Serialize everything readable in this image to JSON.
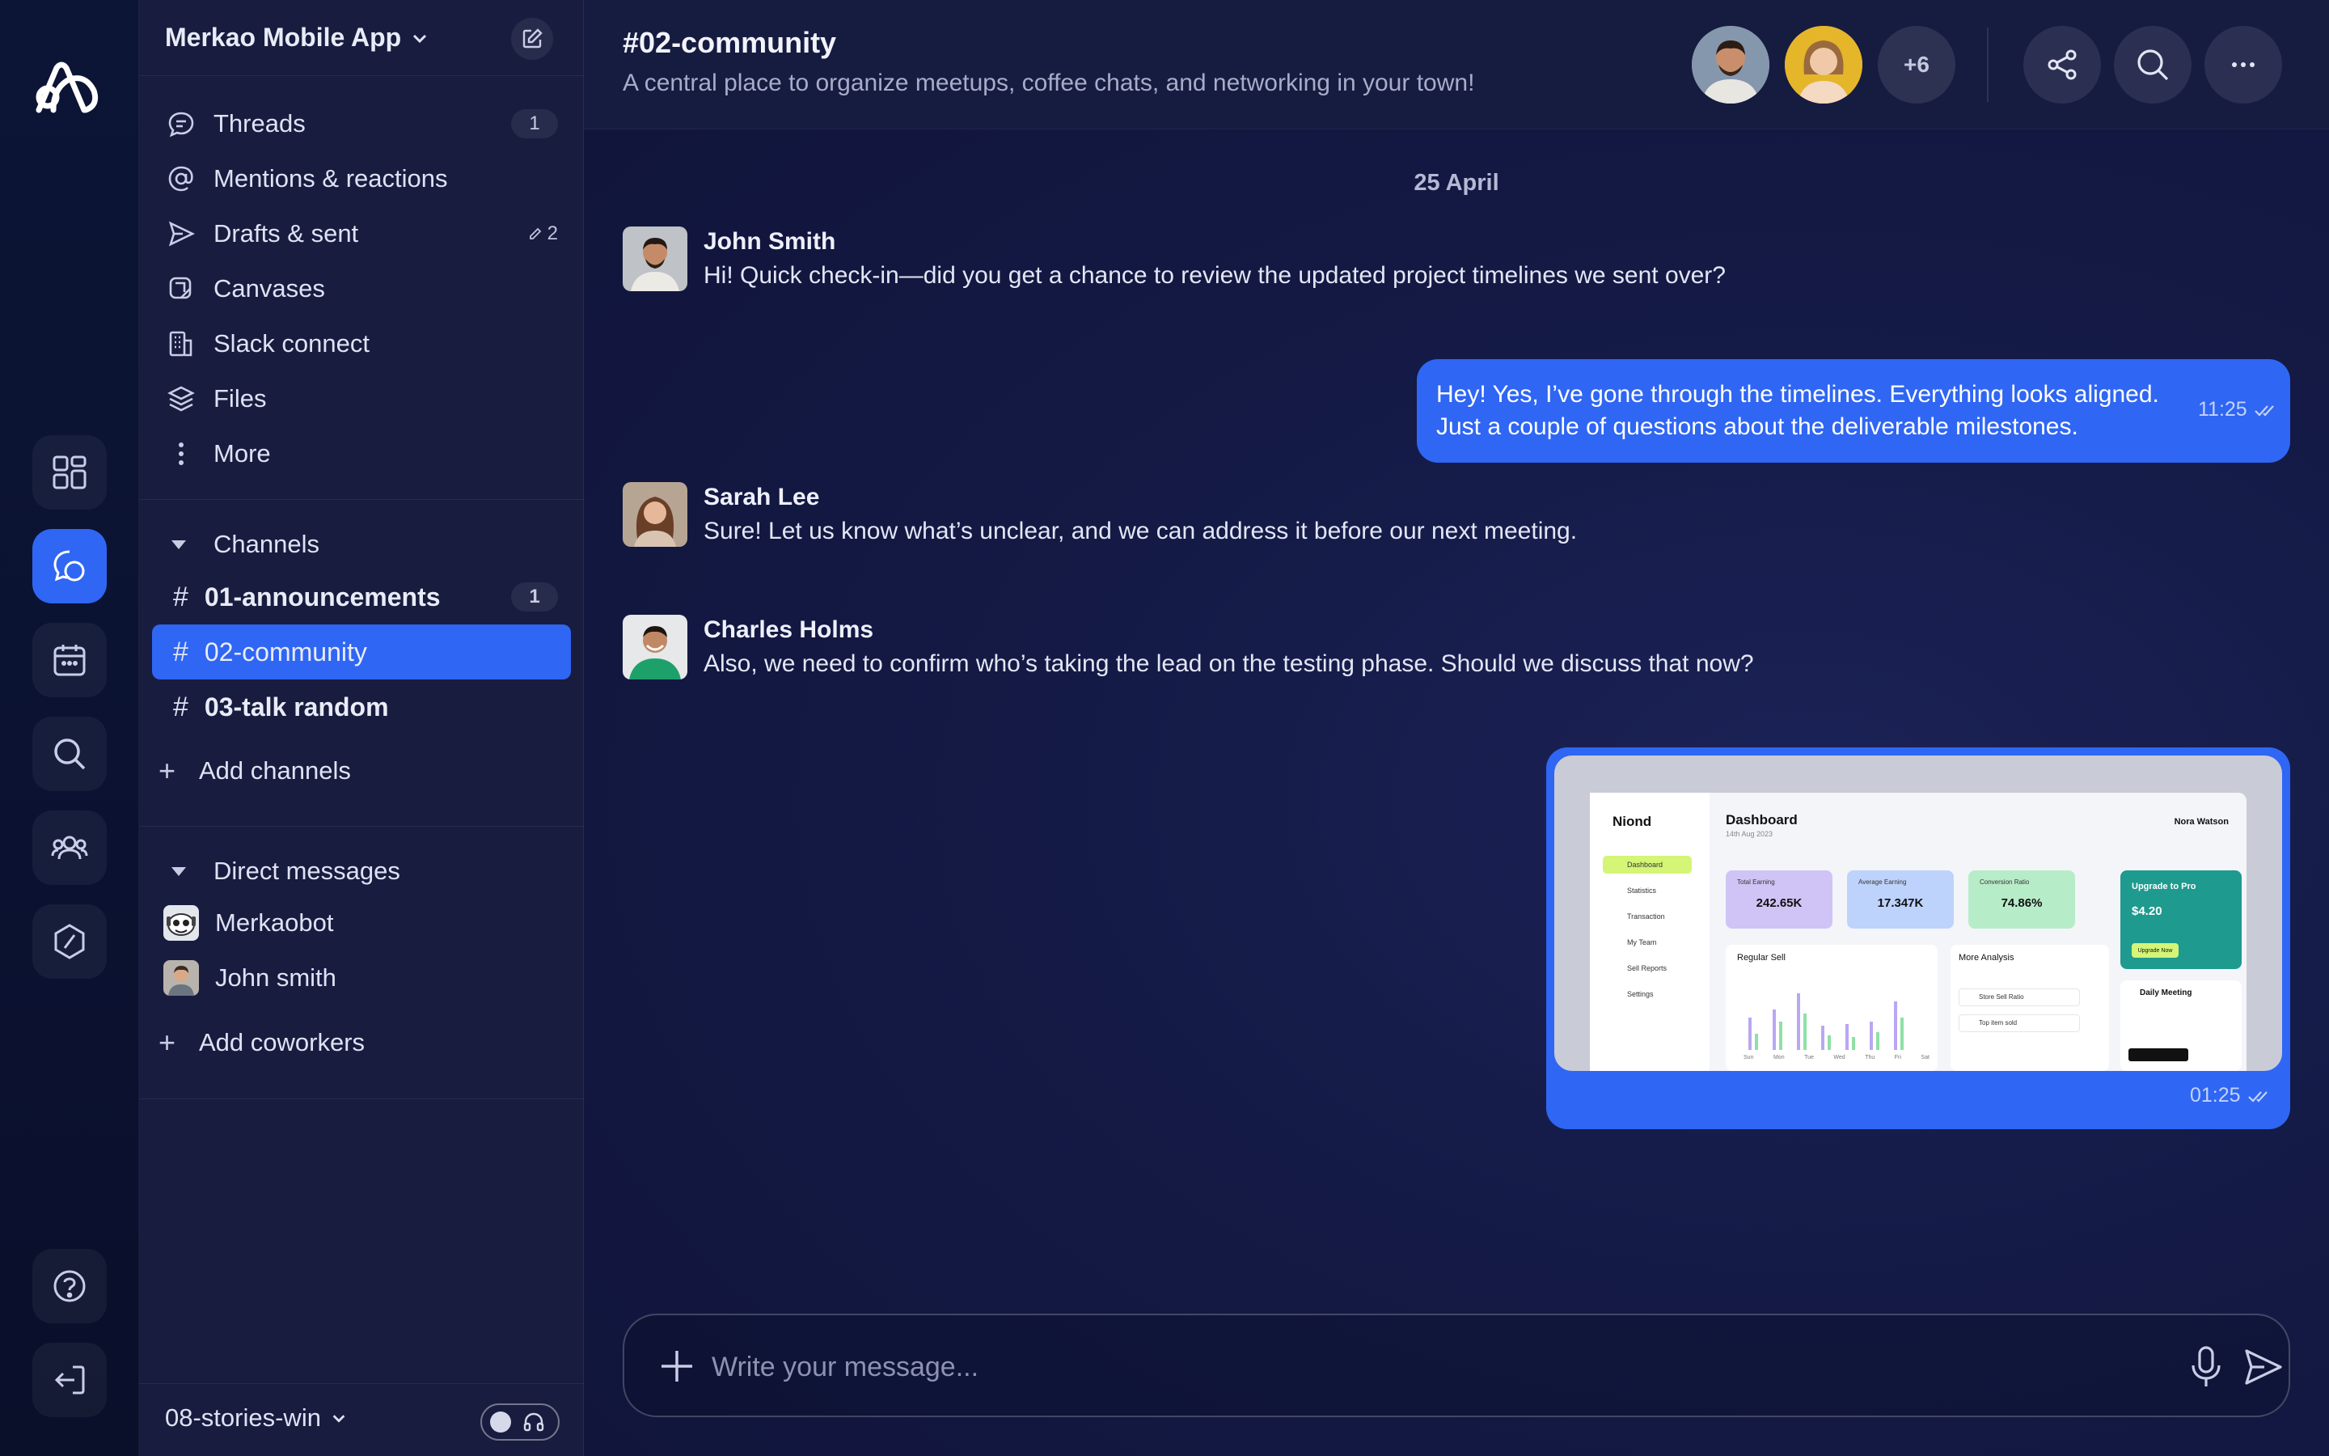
{
  "workspace": {
    "name": "Merkao Mobile App"
  },
  "nav": [
    {
      "label": "Threads",
      "badge": "1"
    },
    {
      "label": "Mentions & reactions"
    },
    {
      "label": "Drafts & sent",
      "drafts": "2"
    },
    {
      "label": "Canvases"
    },
    {
      "label": "Slack connect"
    },
    {
      "label": "Files"
    },
    {
      "label": "More"
    }
  ],
  "channels_section": {
    "title": "Channels",
    "items": [
      {
        "name": "01-announcements",
        "badge": "1"
      },
      {
        "name": "02-community"
      },
      {
        "name": "03-talk random"
      }
    ],
    "add_label": "Add channels"
  },
  "dms_section": {
    "title": "Direct messages",
    "items": [
      {
        "name": "Merkaobot"
      },
      {
        "name": "John smith"
      }
    ],
    "add_label": "Add coworkers"
  },
  "footer": {
    "workspace": "08-stories-win"
  },
  "channel": {
    "title": "#02-community",
    "description": "A central place to organize meetups, coffee chats, and networking in your town!",
    "more_members": "+6"
  },
  "date_separator": "25 April",
  "messages": [
    {
      "author": "John Smith",
      "text": "Hi! Quick check-in—did you get a chance to review the updated project timelines we sent over?"
    },
    {
      "own": true,
      "line1": "Hey! Yes, I’ve gone through the timelines. Everything looks aligned.",
      "line2": "Just a couple of questions about the deliverable milestones.",
      "time": "11:25"
    },
    {
      "author": "Sarah Lee",
      "text": "Sure! Let us know what’s unclear, and we can address it before our next meeting."
    },
    {
      "author": "Charles Holms",
      "text": "Also, we need to confirm who’s taking the lead on the testing phase. Should we discuss that now?"
    },
    {
      "own": true,
      "attachment": true,
      "time": "01:25"
    }
  ],
  "preview": {
    "logo": "Niond",
    "title": "Dashboard",
    "date": "14th Aug 2023",
    "user": "Nora Watson",
    "nav": [
      "Dashboard",
      "Statistics",
      "Transaction",
      "My Team",
      "Sell Reports",
      "Settings"
    ],
    "cards": [
      {
        "label": "Total Earning",
        "value": "242.65K"
      },
      {
        "label": "Average Earning",
        "value": "17.347K"
      },
      {
        "label": "Conversion Ratio",
        "value": "74.86%"
      }
    ],
    "promo_title": "Upgrade to Pro",
    "promo_price": "$4.20",
    "promo_button": "Upgrade Now",
    "chart_title": "Regular Sell",
    "analysis_title": "More Analysis",
    "analysis_items": [
      "Store Sell Ratio",
      "Top item sold"
    ],
    "meeting_title": "Daily Meeting",
    "days": [
      "Sun",
      "Mon",
      "Tue",
      "Wed",
      "Thu",
      "Fri",
      "Sat"
    ]
  },
  "composer": {
    "placeholder": "Write your message..."
  },
  "colors": {
    "accent": "#2f66f3",
    "sidebar": "#181c3f",
    "rail": "#0c1536"
  }
}
